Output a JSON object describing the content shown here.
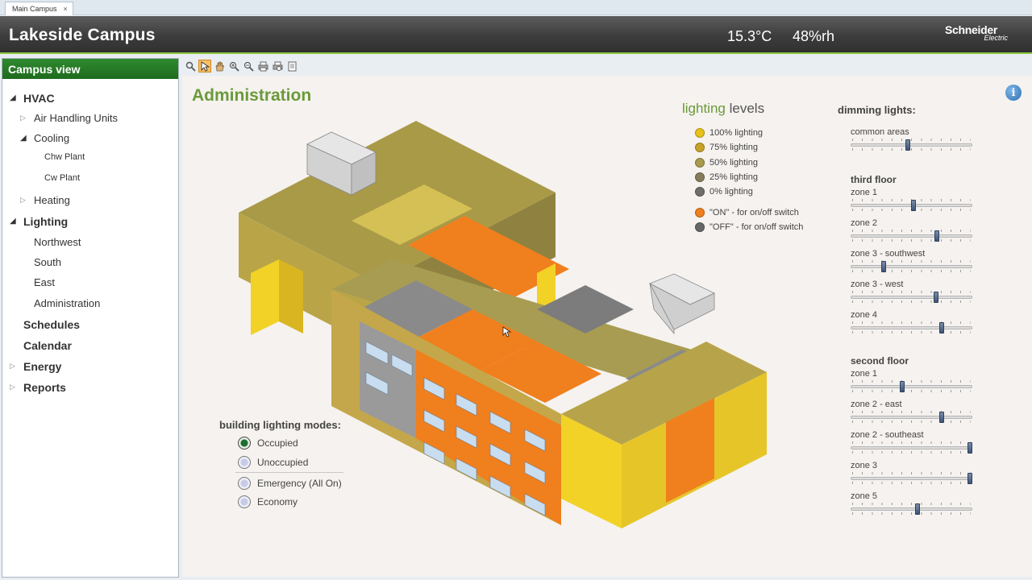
{
  "tab": {
    "label": "Main Campus",
    "close": "×"
  },
  "header": {
    "title": "Lakeside Campus",
    "temperature": "15.3°C",
    "humidity": "48%rh",
    "logo_line1": "Schneider",
    "logo_line2": "Electric"
  },
  "sidebar": {
    "title": "Campus view",
    "items": [
      {
        "label": "HVAC",
        "level": 0,
        "state": "open"
      },
      {
        "label": "Air Handling Units",
        "level": 1,
        "state": "closed"
      },
      {
        "label": "Cooling",
        "level": 1,
        "state": "open"
      },
      {
        "label": "Chw Plant",
        "level": 2,
        "state": "none"
      },
      {
        "label": "Cw Plant",
        "level": 2,
        "state": "none"
      },
      {
        "label": "Heating",
        "level": 1,
        "state": "closed"
      },
      {
        "label": "Lighting",
        "level": 0,
        "state": "open"
      },
      {
        "label": "Northwest",
        "level": 1,
        "state": "none"
      },
      {
        "label": "South",
        "level": 1,
        "state": "none"
      },
      {
        "label": "East",
        "level": 1,
        "state": "none"
      },
      {
        "label": "Administration",
        "level": 1,
        "state": "none"
      },
      {
        "label": "Schedules",
        "level": 0,
        "state": "none"
      },
      {
        "label": "Calendar",
        "level": 0,
        "state": "none"
      },
      {
        "label": "Energy",
        "level": 0,
        "state": "closed"
      },
      {
        "label": "Reports",
        "level": 0,
        "state": "closed"
      }
    ]
  },
  "toolbar": {
    "tools": [
      "zoom-fit-icon",
      "select-pointer-icon",
      "pan-hand-icon",
      "zoom-in-icon",
      "zoom-out-icon",
      "print-icon",
      "print-preview-icon",
      "page-setup-icon"
    ],
    "active_tool": "select-pointer-icon"
  },
  "main": {
    "title": "Administration"
  },
  "legend": {
    "title_highlight": "lighting",
    "title_rest": "levels",
    "items": [
      {
        "label": "100% lighting",
        "color": "#e8c21a"
      },
      {
        "label": "75% lighting",
        "color": "#c7a32a"
      },
      {
        "label": "50% lighting",
        "color": "#a89a4e"
      },
      {
        "label": "25% lighting",
        "color": "#867b5b"
      },
      {
        "label": "0% lighting",
        "color": "#6e6e6e"
      }
    ],
    "switch_items": [
      {
        "label": "\"ON\" - for on/off switch",
        "color": "#f07f1d"
      },
      {
        "label": "\"OFF\" - for on/off switch",
        "color": "#666666"
      }
    ]
  },
  "dimming": {
    "title": "dimming lights:",
    "groups": [
      {
        "heading": "",
        "sliders": [
          {
            "label": "common areas",
            "value": 0.47
          }
        ]
      },
      {
        "heading": "third floor",
        "sliders": [
          {
            "label": "zone 1",
            "value": 0.52
          },
          {
            "label": "zone 2",
            "value": 0.72
          },
          {
            "label": "zone 3 - southwest",
            "value": 0.26
          },
          {
            "label": "zone 3 - west",
            "value": 0.71
          },
          {
            "label": "zone 4",
            "value": 0.76
          }
        ]
      },
      {
        "heading": "second floor",
        "sliders": [
          {
            "label": "zone 1",
            "value": 0.42
          },
          {
            "label": "zone 2 - east",
            "value": 0.76
          },
          {
            "label": "zone 2 - southeast",
            "value": 1.0
          },
          {
            "label": "zone 3",
            "value": 1.0
          },
          {
            "label": "zone 5",
            "value": 0.55
          }
        ]
      }
    ]
  },
  "modes": {
    "title": "building lighting modes:",
    "options": [
      {
        "label": "Occupied",
        "selected": true
      },
      {
        "label": "Unoccupied",
        "selected": false
      },
      {
        "label": "Emergency (All On)",
        "selected": false
      },
      {
        "label": "Economy",
        "selected": false
      }
    ]
  }
}
